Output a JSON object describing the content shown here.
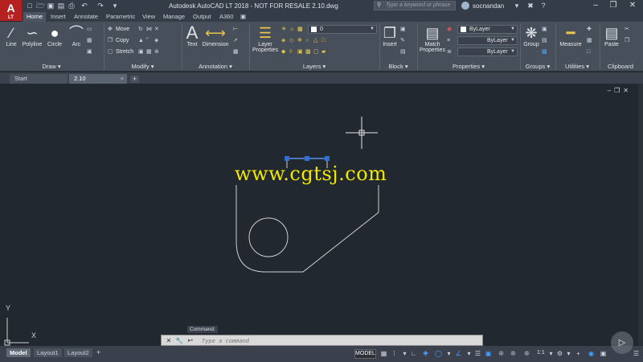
{
  "title_bar": {
    "app_logo": "A",
    "app_logo_sub": "LT",
    "window_title": "Autodesk AutoCAD LT 2018 - NOT FOR RESALE    2.10.dwg",
    "search_placeholder": "Type a keyword or phrase",
    "user_name": "socnandan"
  },
  "ribbon_tabs": [
    "Home",
    "Insert",
    "Annotate",
    "Parametric",
    "View",
    "Manage",
    "Output",
    "A360"
  ],
  "ribbon": {
    "draw": {
      "title": "Draw",
      "tools": [
        "Line",
        "Polyline",
        "Circle",
        "Arc"
      ]
    },
    "modify": {
      "title": "Modify",
      "tools": [
        "Move",
        "Copy",
        "Stretch"
      ]
    },
    "annotation": {
      "title": "Annotation",
      "tools": [
        "Text",
        "Dimension"
      ]
    },
    "layers": {
      "title": "Layers",
      "layer_properties": "Layer Properties",
      "current_layer": "0"
    },
    "block": {
      "title": "Block",
      "insert": "Insert"
    },
    "properties": {
      "title": "Properties",
      "match_properties": "Match Properties",
      "color": "ByLayer",
      "linetype": "ByLayer",
      "lineweight": "ByLayer"
    },
    "groups": {
      "title": "Groups",
      "group": "Group"
    },
    "utilities": {
      "title": "Utilities",
      "measure": "Measure"
    },
    "clipboard": {
      "title": "Clipboard",
      "paste": "Paste"
    }
  },
  "file_tabs": [
    "Start",
    "2.10"
  ],
  "canvas": {
    "watermark": "www.cgtsj.com",
    "ucs_x": "X",
    "ucs_y": "Y"
  },
  "command": {
    "label": "Command:",
    "placeholder": "Type a command"
  },
  "status": {
    "layout_tabs": [
      "Model",
      "Layout1",
      "Layout2"
    ],
    "model_space": "MODEL",
    "scale": "1:1"
  },
  "colors": {
    "canvas_bg": "#212830",
    "ribbon_bg": "#474f5b",
    "watermark": "#f2e800",
    "grip": "#2f6fd6"
  }
}
